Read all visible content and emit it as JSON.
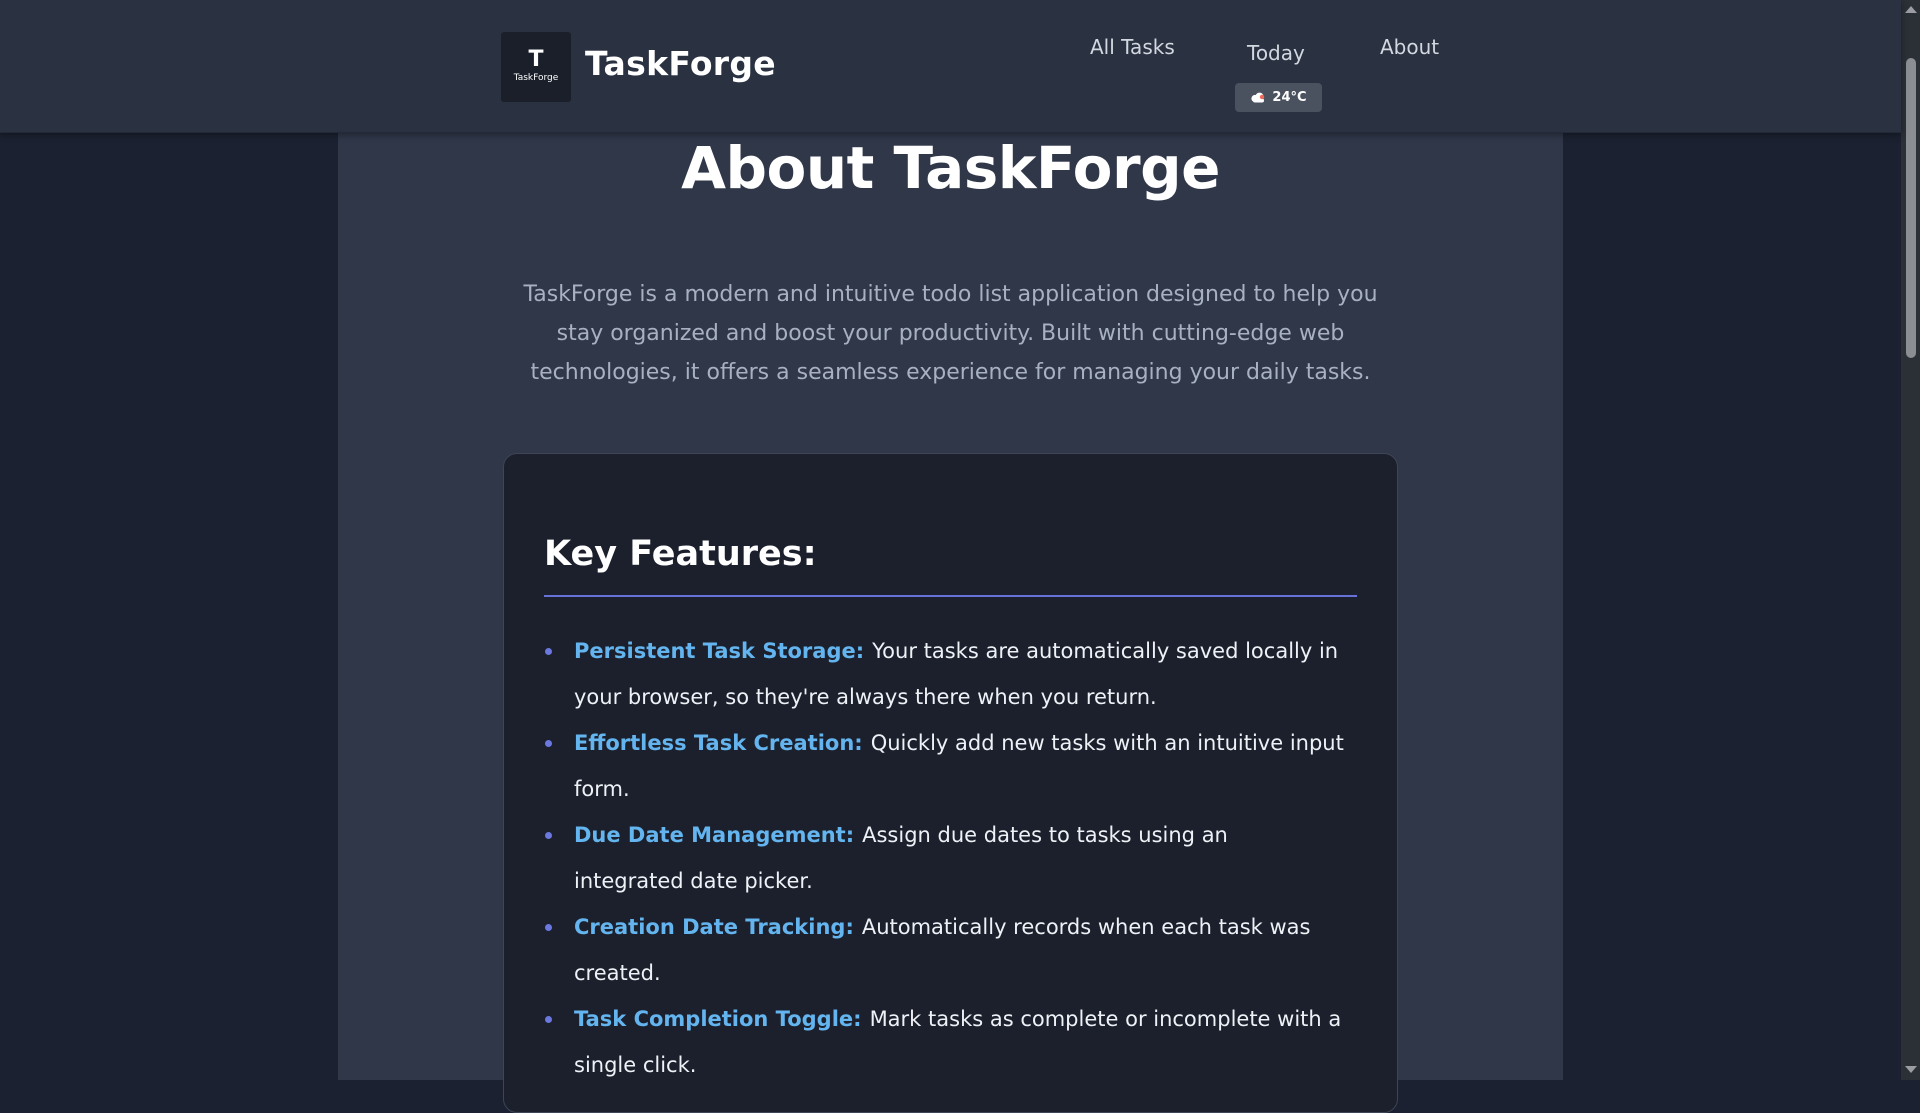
{
  "header": {
    "logo_glyph": "T",
    "logo_text": "TaskForge",
    "brand": "TaskForge",
    "nav": [
      {
        "label": "All Tasks"
      },
      {
        "label": "Today"
      },
      {
        "label": "About"
      }
    ],
    "weather": {
      "temp": "24°C",
      "icon": "cloudy-weather-icon"
    }
  },
  "main": {
    "title": "About TaskForge",
    "intro": "TaskForge is a modern and intuitive todo list application designed to help you stay organized and boost your productivity. Built with cutting-edge web technologies, it offers a seamless experience for managing your daily tasks.",
    "features_heading": "Key Features:",
    "features": [
      {
        "name": "Persistent Task Storage:",
        "desc": "Your tasks are automatically saved locally in your browser, so they're always there when you return."
      },
      {
        "name": "Effortless Task Creation:",
        "desc": "Quickly add new tasks with an intuitive input form."
      },
      {
        "name": "Due Date Management:",
        "desc": "Assign due dates to tasks using an integrated date picker."
      },
      {
        "name": "Creation Date Tracking:",
        "desc": "Automatically records when each task was created."
      },
      {
        "name": "Task Completion Toggle:",
        "desc": "Mark tasks as complete or incomplete with a single click."
      }
    ]
  },
  "colors": {
    "background": "#1b2130",
    "header": "#2a3242",
    "panel": "#2f3749",
    "card": "#1b202c",
    "accent_link": "#63b4ef",
    "rule": "#6672d8"
  }
}
